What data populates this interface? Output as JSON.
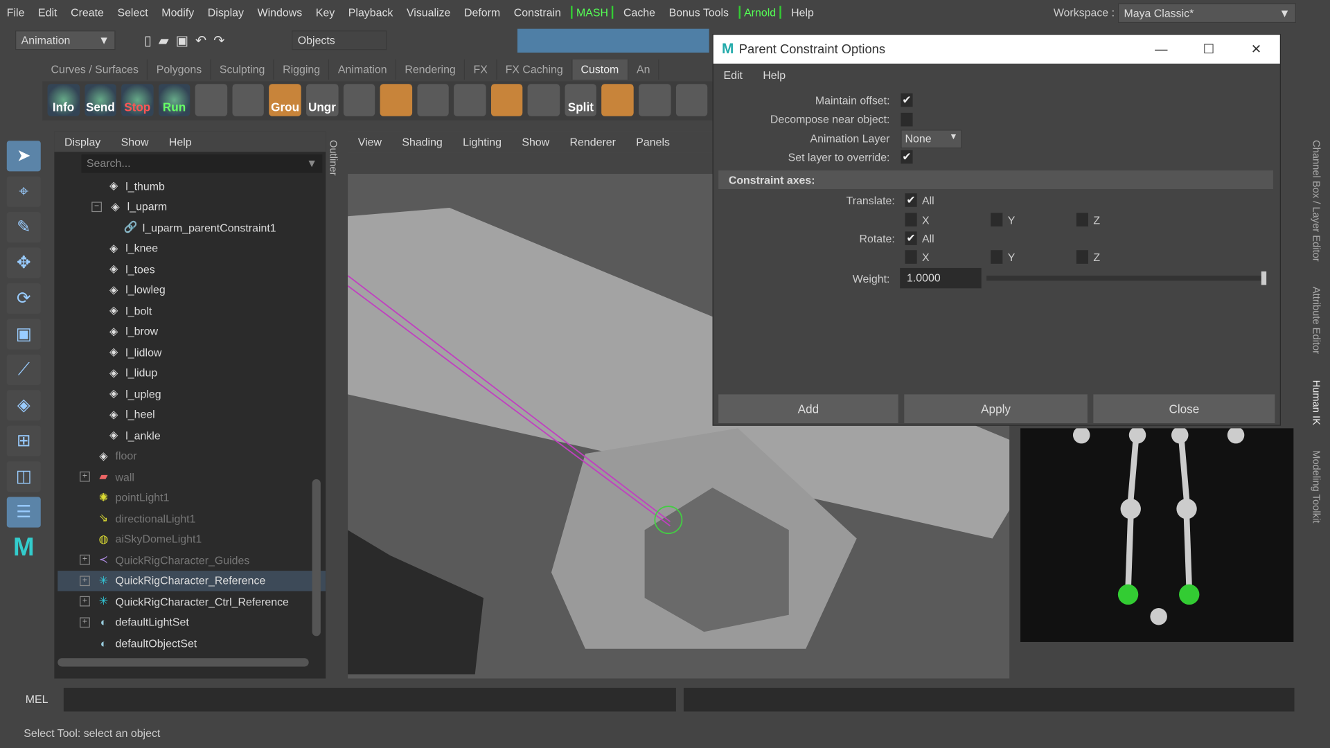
{
  "menubar": {
    "items": [
      "File",
      "Edit",
      "Create",
      "Select",
      "Modify",
      "Display",
      "Windows",
      "Key",
      "Playback",
      "Visualize",
      "Deform",
      "Constrain"
    ],
    "highlight1": "MASH",
    "items2": [
      "Cache",
      "Bonus Tools"
    ],
    "highlight2": "Arnold",
    "help": "Help",
    "workspace_label": "Workspace :",
    "workspace_value": "Maya Classic*"
  },
  "toolbar": {
    "mode": "Animation",
    "selection": "Objects"
  },
  "shelf": {
    "tabs": [
      "Curves / Surfaces",
      "Polygons",
      "Sculpting",
      "Rigging",
      "Animation",
      "Rendering",
      "FX",
      "FX Caching",
      "Custom",
      "An"
    ],
    "active": "Custom",
    "buttons": [
      "Info",
      "Send",
      "Stop",
      "Run",
      "",
      "",
      "Grou",
      "Ungr",
      "",
      "",
      "",
      "",
      "",
      "",
      "Split",
      "",
      "",
      ""
    ]
  },
  "outliner": {
    "side_label": "Outliner",
    "menu": [
      "Display",
      "Show",
      "Help"
    ],
    "search_placeholder": "Search...",
    "items": [
      {
        "label": "l_thumb",
        "icon": "joint-icon",
        "indent": 1
      },
      {
        "label": "l_uparm",
        "icon": "joint-icon",
        "indent": 1,
        "expanded": true
      },
      {
        "label": "l_uparm_parentConstraint1",
        "icon": "constraint-icon",
        "indent": 2
      },
      {
        "label": "l_knee",
        "icon": "joint-icon",
        "indent": 1
      },
      {
        "label": "l_toes",
        "icon": "joint-icon",
        "indent": 1
      },
      {
        "label": "l_lowleg",
        "icon": "joint-icon",
        "indent": 1
      },
      {
        "label": "l_bolt",
        "icon": "joint-icon",
        "indent": 1
      },
      {
        "label": "l_brow",
        "icon": "joint-icon",
        "indent": 1
      },
      {
        "label": "l_lidlow",
        "icon": "joint-icon",
        "indent": 1
      },
      {
        "label": "l_lidup",
        "icon": "joint-icon",
        "indent": 1
      },
      {
        "label": "l_upleg",
        "icon": "joint-icon",
        "indent": 1
      },
      {
        "label": "l_heel",
        "icon": "joint-icon",
        "indent": 1
      },
      {
        "label": "l_ankle",
        "icon": "joint-icon",
        "indent": 1
      },
      {
        "label": "floor",
        "icon": "joint-icon",
        "indent": 0,
        "dim": true
      },
      {
        "label": "wall",
        "icon": "mesh-icon",
        "indent": 0,
        "dim": true,
        "collapsed": true
      },
      {
        "label": "pointLight1",
        "icon": "point-light-icon",
        "indent": 0,
        "dim": true
      },
      {
        "label": "directionalLight1",
        "icon": "directional-light-icon",
        "indent": 0,
        "dim": true
      },
      {
        "label": "aiSkyDomeLight1",
        "icon": "skydome-icon",
        "indent": 0,
        "dim": true
      },
      {
        "label": "QuickRigCharacter_Guides",
        "icon": "guides-icon",
        "indent": 0,
        "dim": true,
        "collapsed": true
      },
      {
        "label": "QuickRigCharacter_Reference",
        "icon": "hik-icon",
        "indent": 0,
        "collapsed": true,
        "selected": true
      },
      {
        "label": "QuickRigCharacter_Ctrl_Reference",
        "icon": "hik-icon",
        "indent": 0,
        "collapsed": true
      },
      {
        "label": "defaultLightSet",
        "icon": "set-icon",
        "indent": 0,
        "collapsed": true
      },
      {
        "label": "defaultObjectSet",
        "icon": "set-icon",
        "indent": 0
      }
    ]
  },
  "viewport": {
    "menu": [
      "View",
      "Shading",
      "Lighting",
      "Show",
      "Renderer",
      "Panels"
    ]
  },
  "dialog": {
    "title": "Parent Constraint Options",
    "menu": [
      "Edit",
      "Help"
    ],
    "maintain_offset_label": "Maintain offset:",
    "maintain_offset": true,
    "decompose_label": "Decompose near object:",
    "decompose": false,
    "anim_layer_label": "Animation Layer",
    "anim_layer_value": "None",
    "override_label": "Set layer to override:",
    "override": true,
    "section": "Constraint axes:",
    "translate_label": "Translate:",
    "rotate_label": "Rotate:",
    "all": "All",
    "x": "X",
    "y": "Y",
    "z": "Z",
    "translate_all": true,
    "rotate_all": true,
    "weight_label": "Weight:",
    "weight_value": "1.0000",
    "weight_slider": 1.0,
    "buttons": [
      "Add",
      "Apply",
      "Close"
    ]
  },
  "right_tabs": [
    "Channel Box / Layer Editor",
    "Attribute Editor",
    "Human IK",
    "Modeling Toolkit"
  ],
  "cmd": {
    "lang": "MEL"
  },
  "status": "Select Tool: select an object",
  "colors": {
    "bg": "#444444",
    "selection": "#3d4a58",
    "accent_green": "#33cc33",
    "viewport": "#5a5a5a"
  }
}
